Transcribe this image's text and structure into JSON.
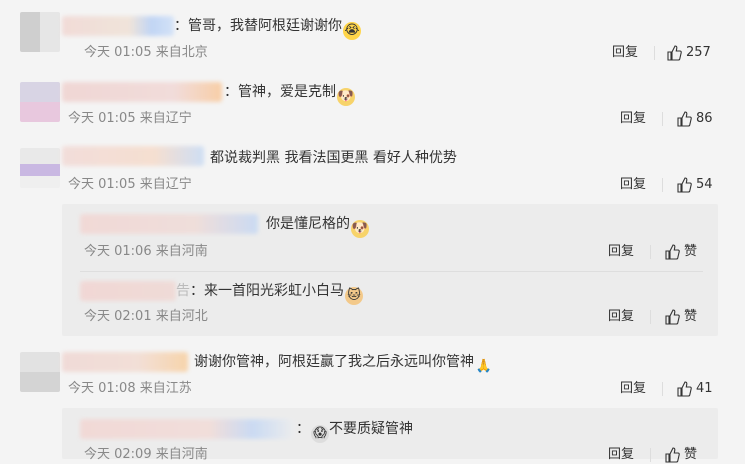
{
  "comments": [
    {
      "text": "：管哥，我替阿根廷谢谢你",
      "emoji": "😭",
      "time": "今天 01:05 来自北京",
      "reply": "回复",
      "likes": "257"
    },
    {
      "text": "：管神，爱是克制",
      "emoji": "🐶",
      "time": "今天 01:05 来自辽宁",
      "reply": "回复",
      "likes": "86"
    },
    {
      "text": "都说裁判黑 我看法国更黑 看好人种优势",
      "time": "今天 01:05 来自辽宁",
      "reply": "回复",
      "likes": "54"
    },
    {
      "text": "谢谢你管神，阿根廷赢了我之后永远叫你管神",
      "emoji": "🙏",
      "time": "今天 01:08 来自江苏",
      "reply": "回复",
      "likes": "41"
    }
  ],
  "replies_group_1": [
    {
      "text": "你是懂尼格的",
      "emoji": "🐶",
      "time": "今天 01:06 来自河南",
      "reply": "回复",
      "like_label": "赞"
    },
    {
      "text": "来一首阳光彩虹小白马",
      "emoji": "🐱",
      "name_suffix": "告",
      "time": "今天 02:01 来自河北",
      "reply": "回复",
      "like_label": "赞"
    }
  ],
  "replies_group_2": [
    {
      "text": "不要质疑管神",
      "emoji": "😱",
      "time": "今天 02:09 来自河南",
      "reply": "回复",
      "like_label": "赞"
    }
  ],
  "icons": {
    "like": "thumb-up-icon"
  }
}
